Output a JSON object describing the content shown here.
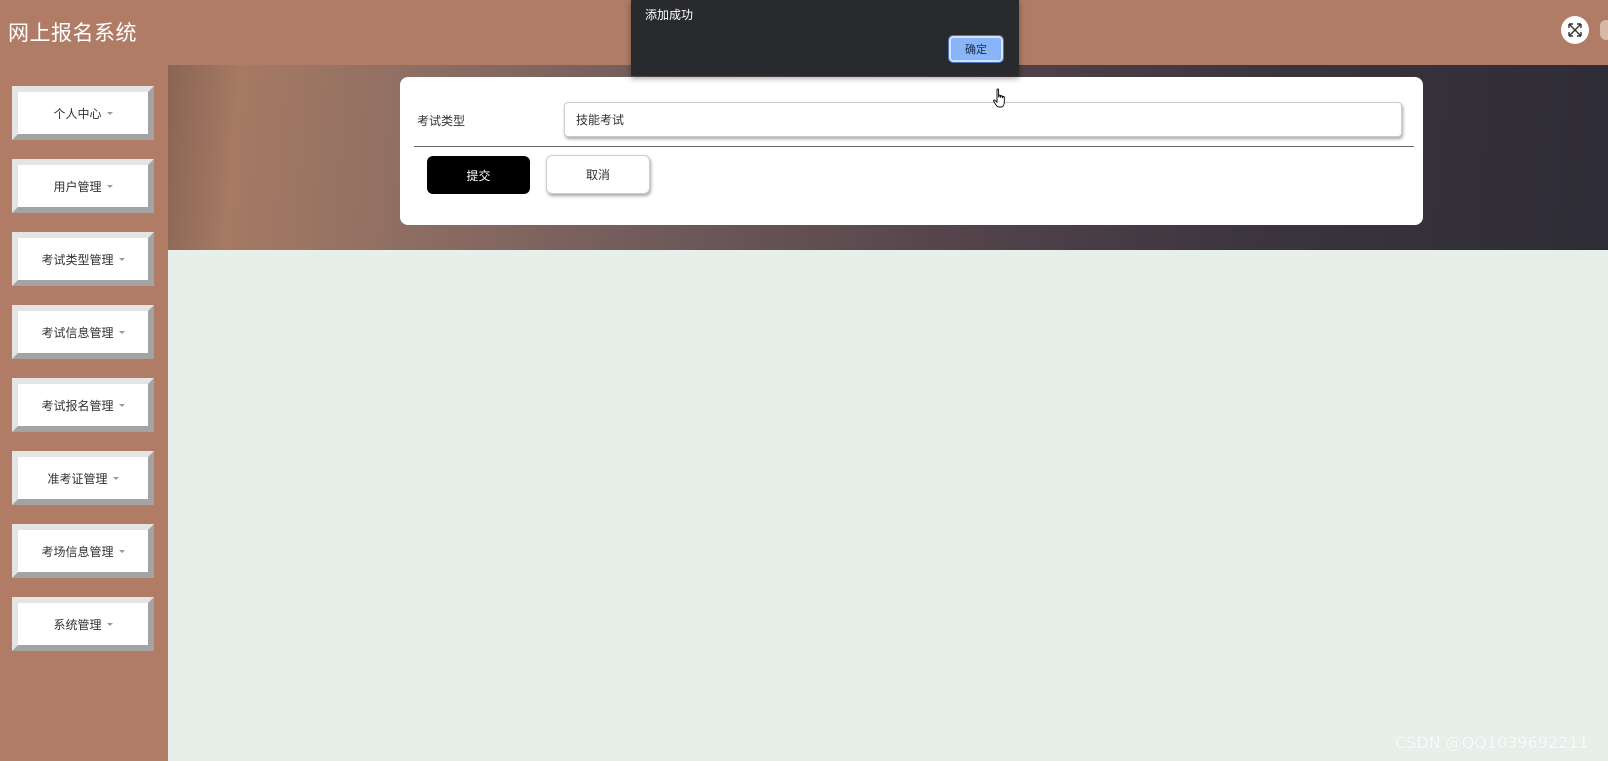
{
  "app": {
    "title": "网上报名系统",
    "fullscreen_icon": "expand-icon"
  },
  "sidebar": {
    "items": [
      {
        "label": "个人中心"
      },
      {
        "label": "用户管理"
      },
      {
        "label": "考试类型管理"
      },
      {
        "label": "考试信息管理"
      },
      {
        "label": "考试报名管理"
      },
      {
        "label": "准考证管理"
      },
      {
        "label": "考场信息管理"
      },
      {
        "label": "系统管理"
      }
    ]
  },
  "form": {
    "field_label": "考试类型",
    "field_value": "技能考试",
    "submit_label": "提交",
    "cancel_label": "取消"
  },
  "dialog": {
    "message": "添加成功",
    "ok_label": "确定"
  },
  "watermark": "CSDN @QQ1039692211",
  "colors": {
    "topbar": "#b07c66",
    "sidebar": "#b07c66",
    "content_bg": "#e6efea",
    "submit_bg": "#000000",
    "dialog_bg": "#292a2d",
    "dialog_ok_bg": "#8ab4f8"
  }
}
